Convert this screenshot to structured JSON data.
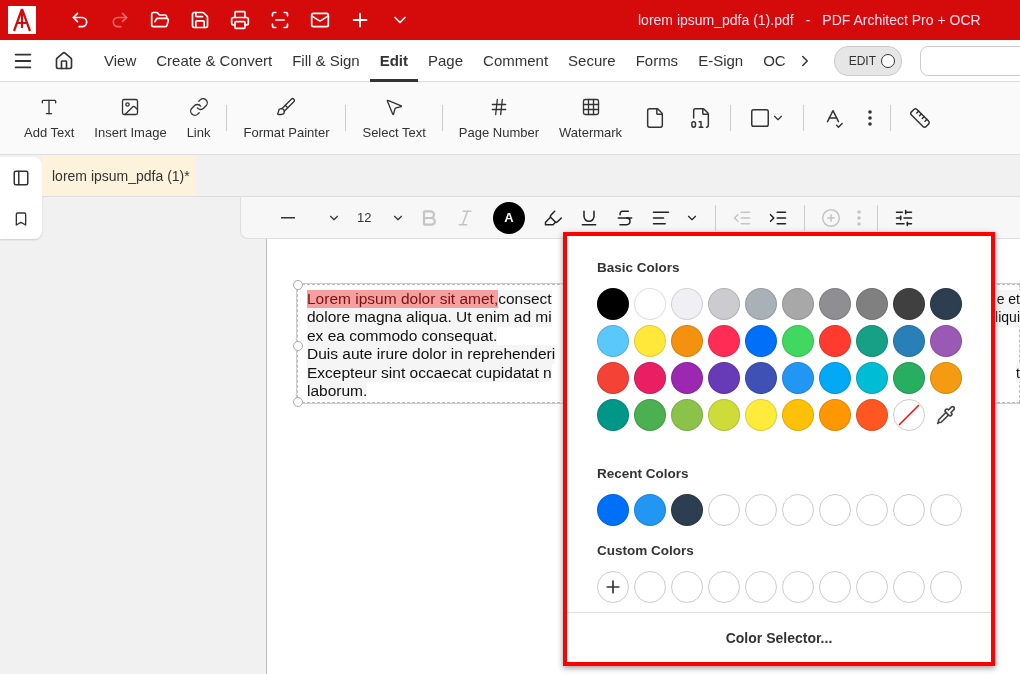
{
  "window": {
    "file_name": "lorem ipsum_pdfa (1).pdf",
    "separator": "-",
    "app_name": "PDF Architect Pro + OCR"
  },
  "menu_tabs": [
    {
      "label": "View",
      "selected": false
    },
    {
      "label": "Create & Convert",
      "selected": false
    },
    {
      "label": "Fill & Sign",
      "selected": false
    },
    {
      "label": "Edit",
      "selected": true
    },
    {
      "label": "Page",
      "selected": false
    },
    {
      "label": "Comment",
      "selected": false
    },
    {
      "label": "Secure",
      "selected": false
    },
    {
      "label": "Forms",
      "selected": false
    },
    {
      "label": "E-Sign",
      "selected": false
    },
    {
      "label": "OC",
      "selected": false
    }
  ],
  "edit_toggle": {
    "label": "EDIT"
  },
  "ribbon": [
    {
      "kind": "button",
      "label": "Add Text"
    },
    {
      "kind": "button",
      "label": "Insert Image"
    },
    {
      "kind": "button",
      "label": "Link"
    },
    {
      "kind": "separator"
    },
    {
      "kind": "button",
      "label": "Format Painter"
    },
    {
      "kind": "separator"
    },
    {
      "kind": "button",
      "label": "Select Text"
    },
    {
      "kind": "separator"
    },
    {
      "kind": "button",
      "label": "Page Number"
    },
    {
      "kind": "button",
      "label": "Watermark"
    },
    {
      "kind": "icon"
    },
    {
      "kind": "icon"
    },
    {
      "kind": "separator"
    },
    {
      "kind": "dropdown"
    },
    {
      "kind": "separator"
    },
    {
      "kind": "icon"
    },
    {
      "kind": "icon"
    },
    {
      "kind": "separator"
    },
    {
      "kind": "icon"
    }
  ],
  "document_tab": {
    "label": "lorem ipsum_pdfa (1)*",
    "modified": true
  },
  "format_toolbar": {
    "font_size": "12",
    "font_color_label": "A",
    "tools": [
      {
        "kind": "bold",
        "disabled": true
      },
      {
        "kind": "italic",
        "disabled": true
      },
      {
        "kind": "color"
      },
      {
        "kind": "highlight",
        "disabled": false
      },
      {
        "kind": "underline",
        "disabled": false
      },
      {
        "kind": "strike",
        "disabled": false
      },
      {
        "kind": "align",
        "disabled": false
      },
      {
        "kind": "separator"
      },
      {
        "kind": "outdent",
        "disabled": true
      },
      {
        "kind": "indent",
        "disabled": false
      },
      {
        "kind": "separator"
      },
      {
        "kind": "add",
        "disabled": true
      },
      {
        "kind": "more",
        "disabled": true
      },
      {
        "kind": "separator"
      },
      {
        "kind": "settings",
        "disabled": false
      }
    ]
  },
  "text_box": {
    "lines": [
      {
        "segments": [
          {
            "text": "Lorem ipsum dolor sit amet,",
            "highlighted": true
          },
          {
            "text": " consect",
            "highlighted": false
          }
        ],
        "right": "e et"
      },
      {
        "segments": [
          {
            "text": "dolore magna aliqua. Ut enim ad mi",
            "highlighted": false
          }
        ],
        "right": "liqui"
      },
      {
        "segments": [
          {
            "text": "ex ea commodo consequat.",
            "highlighted": false
          }
        ]
      },
      {
        "segments": [
          {
            "text": "Duis aute irure dolor in reprehenderi",
            "highlighted": false
          }
        ]
      },
      {
        "segments": [
          {
            "text": "Excepteur sint occaecat cupidatat n",
            "highlighted": false
          }
        ],
        "right": "t"
      },
      {
        "segments": [
          {
            "text": "laborum.",
            "highlighted": false
          }
        ]
      }
    ]
  },
  "color_popup": {
    "basic_title": "Basic Colors",
    "basic": [
      {
        "kind": "swatch",
        "color": "#000000"
      },
      {
        "kind": "swatch",
        "color": "#ffffff"
      },
      {
        "kind": "swatch",
        "color": "#efeff4"
      },
      {
        "kind": "swatch",
        "color": "#cbcbd0"
      },
      {
        "kind": "swatch",
        "color": "#a8b0b8"
      },
      {
        "kind": "swatch",
        "color": "#a8a8a8"
      },
      {
        "kind": "swatch",
        "color": "#8e8e93"
      },
      {
        "kind": "swatch",
        "color": "#808080"
      },
      {
        "kind": "swatch",
        "color": "#404040"
      },
      {
        "kind": "swatch",
        "color": "#2c3e50"
      },
      {
        "kind": "swatch",
        "color": "#5ac8fa"
      },
      {
        "kind": "swatch",
        "color": "#ffe83a"
      },
      {
        "kind": "swatch",
        "color": "#f4920f"
      },
      {
        "kind": "swatch",
        "color": "#ff2d55"
      },
      {
        "kind": "swatch",
        "color": "#0070f8"
      },
      {
        "kind": "swatch",
        "color": "#40d860"
      },
      {
        "kind": "swatch",
        "color": "#ff3b30"
      },
      {
        "kind": "swatch",
        "color": "#16a085"
      },
      {
        "kind": "swatch",
        "color": "#2980b9"
      },
      {
        "kind": "swatch",
        "color": "#9b59b6"
      },
      {
        "kind": "swatch",
        "color": "#f44336"
      },
      {
        "kind": "swatch",
        "color": "#e91e63"
      },
      {
        "kind": "swatch",
        "color": "#9c27b0"
      },
      {
        "kind": "swatch",
        "color": "#673ab7"
      },
      {
        "kind": "swatch",
        "color": "#3f51b5"
      },
      {
        "kind": "swatch",
        "color": "#2196f3"
      },
      {
        "kind": "swatch",
        "color": "#03a9f4"
      },
      {
        "kind": "swatch",
        "color": "#00bcd4"
      },
      {
        "kind": "swatch",
        "color": "#27ae60"
      },
      {
        "kind": "swatch",
        "color": "#f39c12"
      },
      {
        "kind": "swatch",
        "color": "#009688"
      },
      {
        "kind": "swatch",
        "color": "#4caf50"
      },
      {
        "kind": "swatch",
        "color": "#8bc34a"
      },
      {
        "kind": "swatch",
        "color": "#cddc39"
      },
      {
        "kind": "swatch",
        "color": "#ffeb3b"
      },
      {
        "kind": "swatch",
        "color": "#ffc107"
      },
      {
        "kind": "swatch",
        "color": "#ff9800"
      },
      {
        "kind": "swatch",
        "color": "#ff5722"
      },
      {
        "kind": "none"
      },
      {
        "kind": "eyedropper"
      }
    ],
    "recent_title": "Recent Colors",
    "recent": [
      {
        "kind": "swatch",
        "color": "#0070f8"
      },
      {
        "kind": "swatch",
        "color": "#2196f3"
      },
      {
        "kind": "swatch",
        "color": "#2c3e50"
      },
      {
        "kind": "empty"
      },
      {
        "kind": "empty"
      },
      {
        "kind": "empty"
      },
      {
        "kind": "empty"
      },
      {
        "kind": "empty"
      },
      {
        "kind": "empty"
      },
      {
        "kind": "empty"
      }
    ],
    "custom_title": "Custom Colors",
    "custom": [
      {
        "kind": "add"
      },
      {
        "kind": "empty"
      },
      {
        "kind": "empty"
      },
      {
        "kind": "empty"
      },
      {
        "kind": "empty"
      },
      {
        "kind": "empty"
      },
      {
        "kind": "empty"
      },
      {
        "kind": "empty"
      },
      {
        "kind": "empty"
      },
      {
        "kind": "empty"
      }
    ],
    "footer_button": "Color Selector..."
  }
}
